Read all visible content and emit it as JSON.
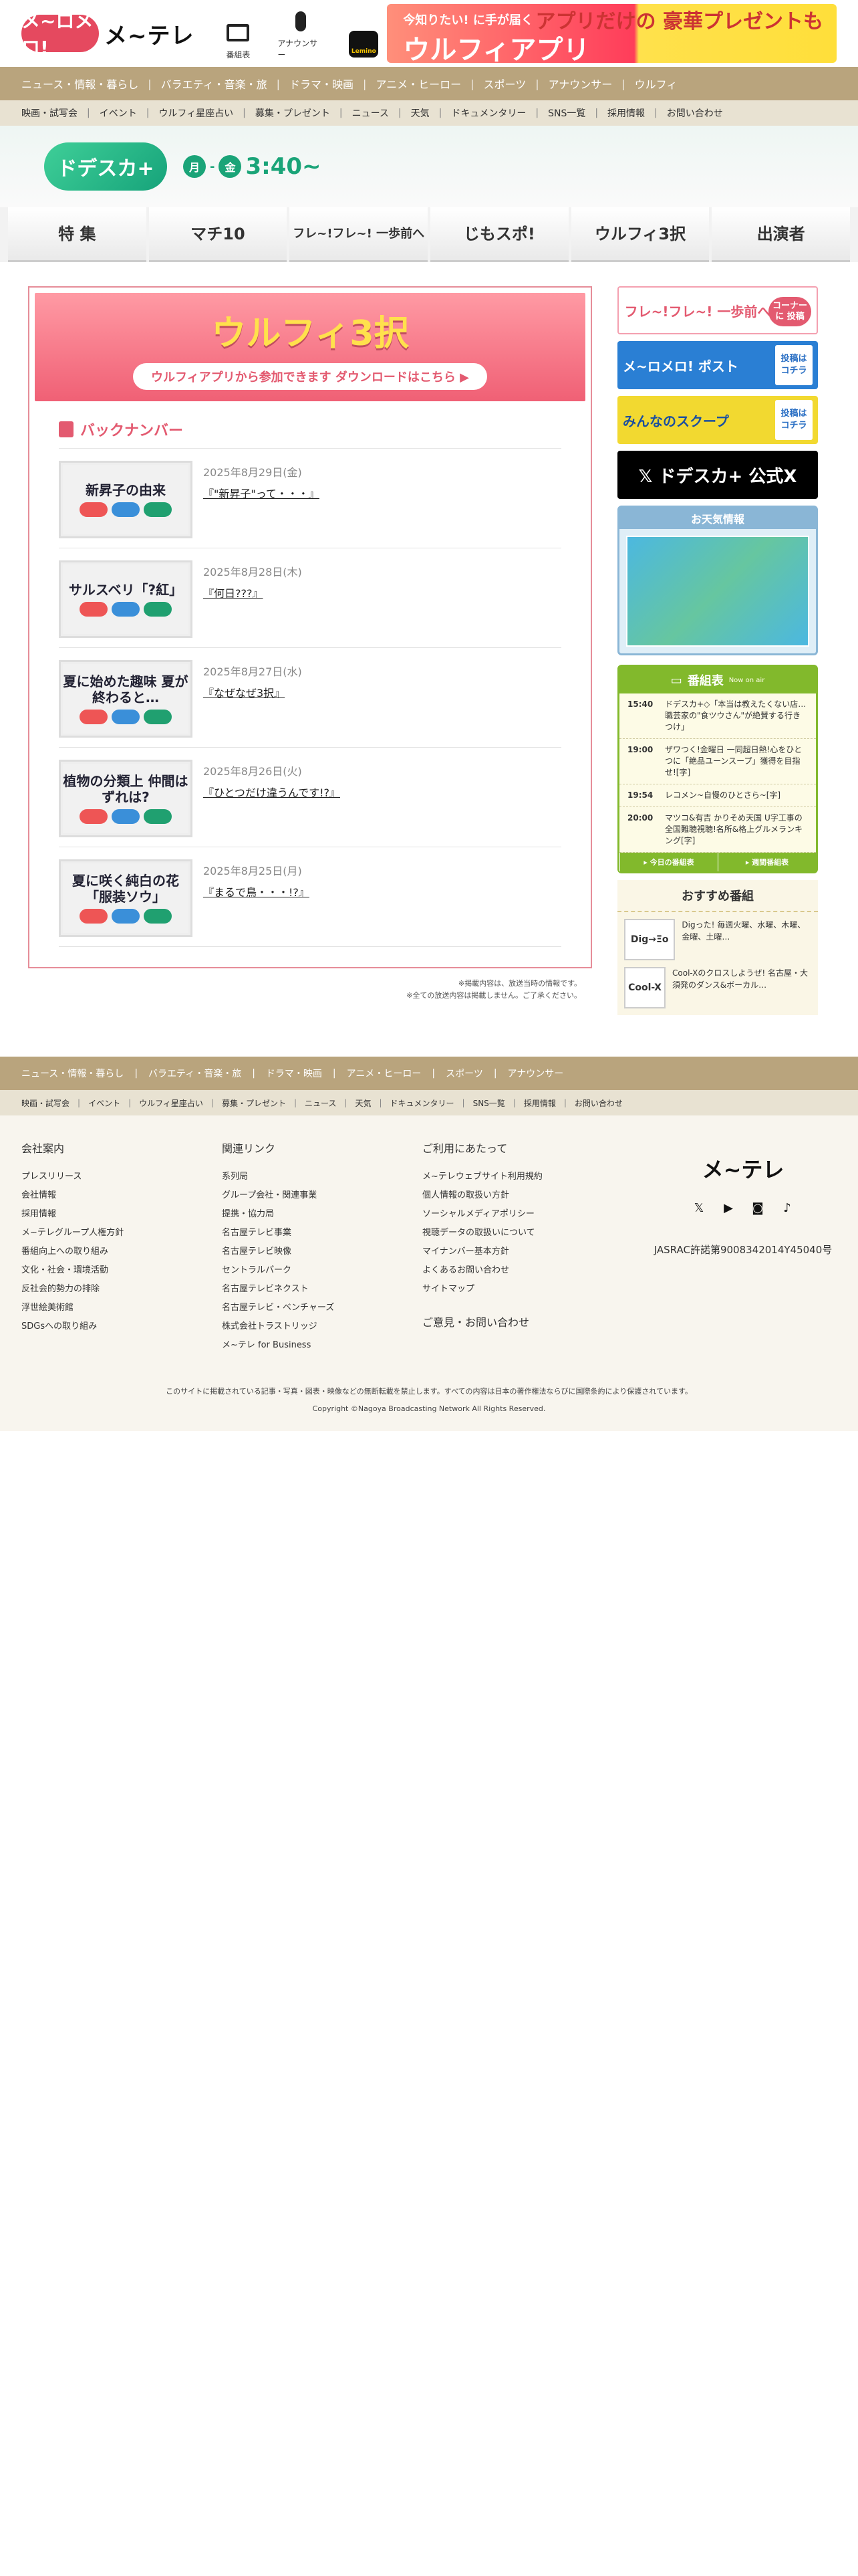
{
  "header": {
    "logo_badge": "メ~ロメロ!",
    "logo_name": "メ~テレ",
    "icons": [
      {
        "label": "番組表",
        "icon": "tv-icon"
      },
      {
        "label": "アナウンサー",
        "icon": "mic-icon"
      },
      {
        "label": "Lemino",
        "icon": "lemino-icon"
      }
    ],
    "banner": {
      "line1": "今知りたい! に手が届く",
      "line2": "ウルフィアプリ",
      "line3": "アプリだけの 豪華プレゼントも"
    }
  },
  "global_nav": [
    "ニュース・情報・暮らし",
    "バラエティ・音楽・旅",
    "ドラマ・映画",
    "アニメ・ヒーロー",
    "スポーツ",
    "アナウンサー",
    "ウルフィ"
  ],
  "sub_nav": [
    "映画・試写会",
    "イベント",
    "ウルフィ星座占い",
    "募集・プレゼント",
    "ニュース",
    "天気",
    "ドキュメンタリー",
    "SNS一覧",
    "採用情報",
    "お問い合わせ"
  ],
  "hero": {
    "logo": "ドデスカ+",
    "day1": "月",
    "day2": "金",
    "time": "3:40~"
  },
  "tabs": [
    "特 集",
    "マチ10",
    "フレ~!フレ~! 一歩前へ",
    "じもスポ!",
    "ウルフィ3択",
    "出演者"
  ],
  "feature": {
    "title": "ウルフィ3択",
    "button": "ウルフィアプリから参加できます ダウンロードはこちら ▶"
  },
  "back_numbers": {
    "title": "バックナンバー",
    "items": [
      {
        "thumb": "新昇子の由来",
        "date": "2025年8月29日(金)",
        "title": "『\"新昇子\"って・・・』"
      },
      {
        "thumb": "サルスベリ「?紅」",
        "date": "2025年8月28日(木)",
        "title": "『何日???』"
      },
      {
        "thumb": "夏に始めた趣味 夏が終わると…",
        "date": "2025年8月27日(水)",
        "title": "『なぜなぜ3択』"
      },
      {
        "thumb": "植物の分類上 仲間はずれは?",
        "date": "2025年8月26日(火)",
        "title": "『ひとつだけ違うんです!?』"
      },
      {
        "thumb": "夏に咲く純白の花「服装ソウ」",
        "date": "2025年8月25日(月)",
        "title": "『まるで鳥・・・!?』"
      }
    ]
  },
  "notes": [
    "※掲載内容は、放送当時の情報です。",
    "※全ての放送内容は掲載しません。ご了承ください。"
  ],
  "sidebar": {
    "b1": "フレ~!フレ~! 一歩前へ",
    "b1_tag": "コーナーに 投稿",
    "b2": "メ~ロメロ! ポスト",
    "b2_side": "投稿は コチラ",
    "b3": "みんなのスクープ",
    "b3_side": "投稿は コチラ",
    "b4": "𝕏 ドデスカ+ 公式X",
    "weather": "お天気情報",
    "program": {
      "title": "番組表",
      "sub": "Now on air",
      "rows": [
        {
          "time": "15:40",
          "text": "ドデスカ+◇「本当は教えたくない店…職芸家の\"食ツウさん\"が絶賛する行きつけ」"
        },
        {
          "time": "19:00",
          "text": "ザワつく!金曜日 一同超日熱!心をひとつに「絶品ユーンスープ」獲得を目指せ![字]"
        },
        {
          "time": "19:54",
          "text": "レコメン~自慢のひとさら~[字]"
        },
        {
          "time": "20:00",
          "text": "マツコ&有吉 かりそめ天国 U字工事の全国難聴視聴!名所&格上グルメランキング[字]"
        }
      ],
      "link1": "▸ 今日の番組表",
      "link2": "▸ 週間番組表"
    },
    "recommend": {
      "title": "おすすめ番組",
      "items": [
        {
          "img": "Dig→Ξο",
          "text": "Digった! 毎週火曜、水曜、木曜、金曜、土曜…"
        },
        {
          "img": "Cool-X",
          "text": "Cool-Xのクロスしようぜ! 名古屋・大須発のダンス&ボーカル…"
        }
      ]
    }
  },
  "footer": {
    "global_nav": [
      "ニュース・情報・暮らし",
      "バラエティ・音楽・旅",
      "ドラマ・映画",
      "アニメ・ヒーロー",
      "スポーツ",
      "アナウンサー"
    ],
    "sub_nav": [
      "映画・試写会",
      "イベント",
      "ウルフィ星座占い",
      "募集・プレゼント",
      "ニュース",
      "天気",
      "ドキュメンタリー",
      "SNS一覧",
      "採用情報",
      "お問い合わせ"
    ],
    "col1": {
      "title": "会社案内",
      "items": [
        "プレスリリース",
        "会社情報",
        "採用情報",
        "メ~テレグループ人権方針",
        "番組向上への取り組み",
        "文化・社会・環境活動",
        "反社会的勢力の排除",
        "浮世絵美術館",
        "SDGsへの取り組み"
      ]
    },
    "col2": {
      "title": "関連リンク",
      "items": [
        "系列局",
        "グループ会社・関連事業",
        "提携・協力局",
        "名古屋テレビ事業",
        "名古屋テレビ映像",
        "セントラルパーク",
        "名古屋テレビネクスト",
        "名古屋テレビ・ベンチャーズ",
        "株式会社トラストリッジ",
        "メ~テレ for Business"
      ]
    },
    "col3": {
      "title": "ご利用にあたって",
      "items": [
        "メ~テレウェブサイト利用規約",
        "個人情報の取扱い方針",
        "ソーシャルメディアポリシー",
        "視聴データの取扱いについて",
        "マイナンバー基本方針",
        "よくあるお問い合わせ",
        "サイトマップ"
      ],
      "extra": "ご意見・お問い合わせ"
    },
    "brand": "メ~テレ",
    "jasrac": "JASRAC許諾第9008342014Y45040号",
    "notice": "このサイトに掲載されている記事・写真・図表・映像などの無断転載を禁止します。すべての内容は日本の著作権法ならびに国際条約により保護されています。",
    "copyright": "Copyright ©Nagoya Broadcasting Network All Rights Reserved."
  }
}
